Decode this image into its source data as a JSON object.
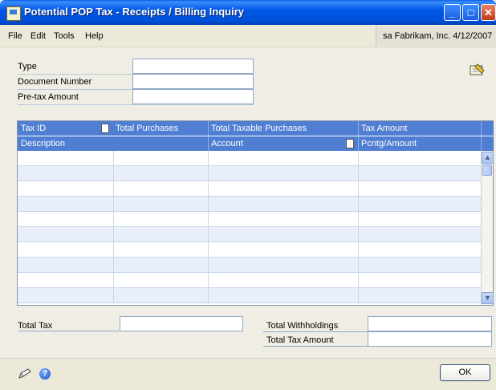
{
  "window": {
    "title": "Potential POP Tax - Receipts / Billing Inquiry",
    "min_glyph": "_",
    "max_glyph": "□",
    "close_glyph": "✕"
  },
  "menu": {
    "file": "File",
    "edit": "Edit",
    "tools": "Tools",
    "help": "Help"
  },
  "user_info": "sa  Fabrikam, Inc.  4/12/2007",
  "header": {
    "type_label": "Type",
    "type_value": "",
    "docnum_label": "Document Number",
    "docnum_value": "",
    "pretax_label": "Pre-tax Amount",
    "pretax_value": ""
  },
  "grid": {
    "columns_row1": [
      "Tax ID",
      "Total Purchases",
      "Total Taxable Purchases",
      "Tax Amount"
    ],
    "columns_row2": [
      "Description",
      "Account",
      "Pcntg/Amount"
    ],
    "rows": [
      "",
      "",
      "",
      "",
      "",
      "",
      "",
      "",
      "",
      ""
    ]
  },
  "totals": {
    "total_tax_label": "Total Tax",
    "total_tax_value": "",
    "total_withholdings_label": "Total Withholdings",
    "total_withholdings_value": "",
    "total_tax_amount_label": "Total Tax Amount",
    "total_tax_amount_value": ""
  },
  "footer": {
    "ok_label": "OK",
    "help_glyph": "?"
  },
  "icons": [
    "app-icon",
    "note-icon",
    "doc-icon",
    "pencil-icon",
    "help-icon",
    "scroll-up-icon",
    "scroll-down-icon"
  ]
}
